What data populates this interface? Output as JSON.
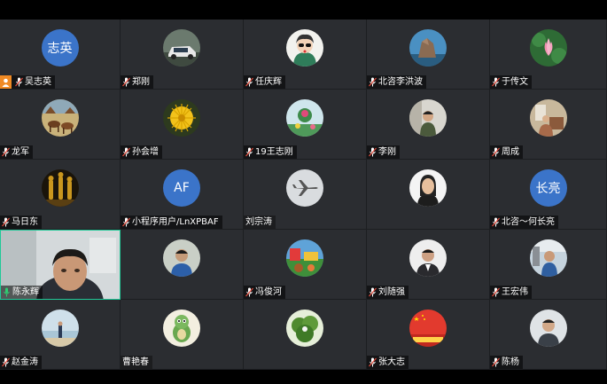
{
  "participants": [
    {
      "name": "吴志英",
      "avatar_text": "志英",
      "avatar_type": "text",
      "mic": "muted",
      "host": true
    },
    {
      "name": "郑刚",
      "avatar_type": "photo",
      "avatar_desc": "car-photo",
      "mic": "muted"
    },
    {
      "name": "任庆辉",
      "avatar_type": "photo",
      "avatar_desc": "cartoon-girl",
      "mic": "muted"
    },
    {
      "name": "北咨李洪波",
      "avatar_type": "photo",
      "avatar_desc": "rock-landscape",
      "mic": "muted"
    },
    {
      "name": "于传文",
      "avatar_type": "photo",
      "avatar_desc": "lotus-flower",
      "mic": "muted"
    },
    {
      "name": "龙军",
      "avatar_type": "photo",
      "avatar_desc": "horses-scene",
      "mic": "muted"
    },
    {
      "name": "孙会增",
      "avatar_type": "photo",
      "avatar_desc": "yellow-flower",
      "mic": "muted"
    },
    {
      "name": "19王志刚",
      "avatar_type": "photo",
      "avatar_desc": "flower-garden",
      "mic": "muted"
    },
    {
      "name": "李刚",
      "avatar_type": "photo",
      "avatar_desc": "man-standing",
      "mic": "muted"
    },
    {
      "name": "周成",
      "avatar_type": "photo",
      "avatar_desc": "room-interior",
      "mic": "muted"
    },
    {
      "name": "马日东",
      "avatar_type": "photo",
      "avatar_desc": "oscar-statues",
      "mic": "muted"
    },
    {
      "name": "小程序用户/LnXPBAF",
      "avatar_text": "AF",
      "avatar_type": "text",
      "mic": "muted"
    },
    {
      "name": "刘宗涛",
      "avatar_type": "photo",
      "avatar_desc": "airplane",
      "mic": "none"
    },
    {
      "name": "",
      "avatar_type": "photo",
      "avatar_desc": "woman-portrait",
      "mic": "none"
    },
    {
      "name": "北咨～何长亮",
      "avatar_text": "长亮",
      "avatar_type": "text",
      "mic": "muted"
    },
    {
      "name": "陈永辉",
      "avatar_type": "video",
      "mic": "active"
    },
    {
      "name": "",
      "avatar_type": "photo",
      "avatar_desc": "man-blue-shirt",
      "mic": "none"
    },
    {
      "name": "冯俊河",
      "avatar_type": "photo",
      "avatar_desc": "colorful-scene",
      "mic": "muted"
    },
    {
      "name": "刘随强",
      "avatar_type": "photo",
      "avatar_desc": "man-suit",
      "mic": "muted"
    },
    {
      "name": "王宏伟",
      "avatar_type": "photo",
      "avatar_desc": "man-outdoor",
      "mic": "muted"
    },
    {
      "name": "赵金涛",
      "avatar_type": "photo",
      "avatar_desc": "person-beach",
      "mic": "muted"
    },
    {
      "name": "曹艳春",
      "avatar_type": "photo",
      "avatar_desc": "cartoon-dinosaur",
      "mic": "none"
    },
    {
      "name": "",
      "avatar_type": "photo",
      "avatar_desc": "green-plant",
      "mic": "none"
    },
    {
      "name": "张大志",
      "avatar_type": "photo",
      "avatar_desc": "china-flag",
      "mic": "muted"
    },
    {
      "name": "陈杨",
      "avatar_type": "photo",
      "avatar_desc": "man-portrait",
      "mic": "muted"
    }
  ],
  "colors": {
    "tile_bg": "#2b2d31",
    "avatar_blue": "#3b74c9",
    "active_border": "#20c997",
    "host_badge": "#f08a24"
  }
}
